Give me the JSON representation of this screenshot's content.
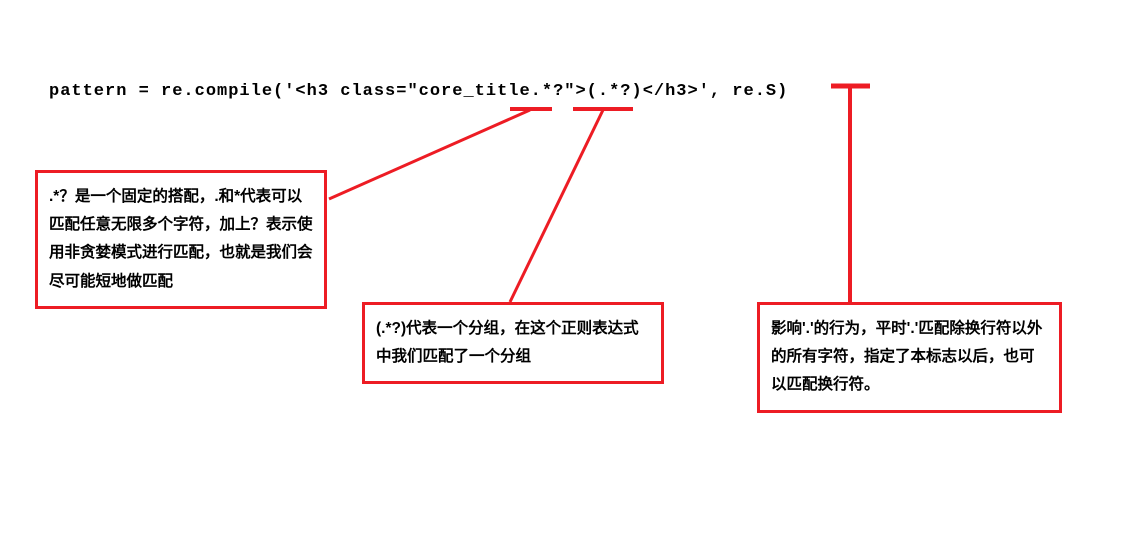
{
  "code": "pattern = re.compile('<h3 class=\"core_title.*?\">(.*?)</h3>', re.S)",
  "annotations": {
    "box1": ".*？是一个固定的搭配，.和*代表可以匹配任意无限多个字符，加上？表示使用非贪婪模式进行匹配，也就是我们会尽可能短地做匹配",
    "box2": "(.*?)代表一个分组，在这个正则表达式中我们匹配了一个分组",
    "box3": "影响'.'的行为，平时'.'匹配除换行符以外的所有字符，指定了本标志以后，也可以匹配换行符。"
  },
  "colors": {
    "annotation": "#ed1c24",
    "text": "#000000",
    "background": "#ffffff"
  }
}
